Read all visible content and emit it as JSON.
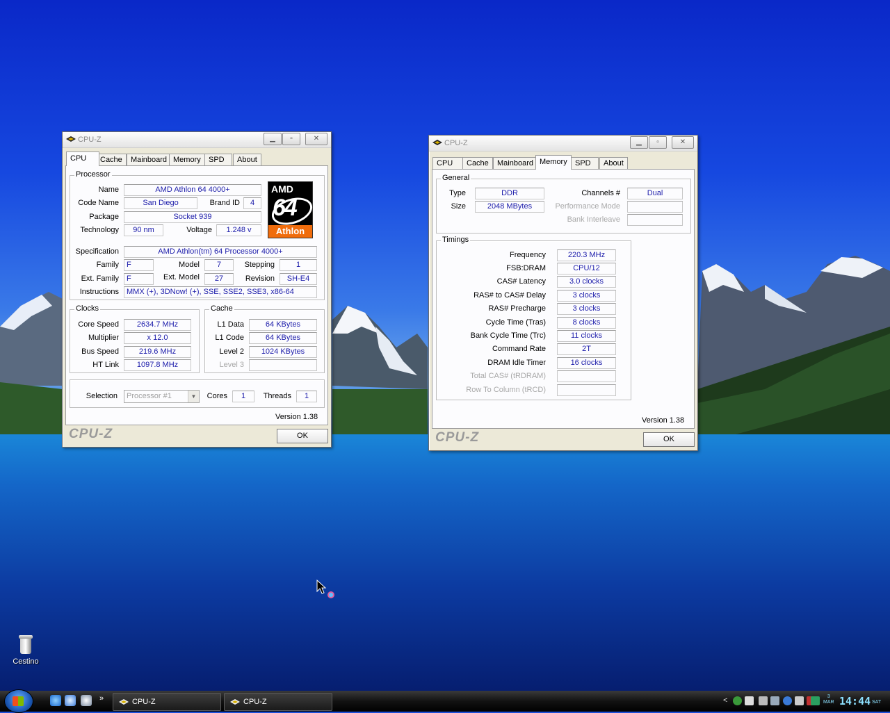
{
  "desktop": {
    "icons": [
      {
        "label": "Cestino",
        "icon": "recycle-bin-icon"
      }
    ]
  },
  "cpu_window": {
    "title": "CPU-Z",
    "tabs": [
      "CPU",
      "Cache",
      "Mainboard",
      "Memory",
      "SPD",
      "About"
    ],
    "active_tab": "CPU",
    "processor": {
      "legend": "Processor",
      "name_label": "Name",
      "name": "AMD Athlon 64 4000+",
      "codename_label": "Code Name",
      "codename": "San Diego",
      "brandid_label": "Brand ID",
      "brandid": "4",
      "package_label": "Package",
      "package": "Socket 939",
      "technology_label": "Technology",
      "technology": "90 nm",
      "voltage_label": "Voltage",
      "voltage": "1.248 v",
      "spec_label": "Specification",
      "spec": "AMD Athlon(tm) 64 Processor 4000+",
      "family_label": "Family",
      "family": "F",
      "model_label": "Model",
      "model": "7",
      "stepping_label": "Stepping",
      "stepping": "1",
      "extfamily_label": "Ext. Family",
      "extfamily": "F",
      "extmodel_label": "Ext. Model",
      "extmodel": "27",
      "revision_label": "Revision",
      "revision": "SH-E4",
      "instructions_label": "Instructions",
      "instructions": "MMX (+), 3DNow! (+), SSE, SSE2, SSE3, x86-64"
    },
    "logo": {
      "top": "AMD",
      "middle": "64",
      "bottom": "Athlon"
    },
    "clocks": {
      "legend": "Clocks",
      "core_label": "Core Speed",
      "core": "2634.7 MHz",
      "mult_label": "Multiplier",
      "mult": "x 12.0",
      "bus_label": "Bus Speed",
      "bus": "219.6 MHz",
      "ht_label": "HT Link",
      "ht": "1097.8 MHz"
    },
    "cache": {
      "legend": "Cache",
      "l1d_label": "L1 Data",
      "l1d": "64 KBytes",
      "l1c_label": "L1 Code",
      "l1c": "64 KBytes",
      "l2_label": "Level 2",
      "l2": "1024 KBytes",
      "l3_label": "Level 3",
      "l3": ""
    },
    "selection": {
      "label": "Selection",
      "value": "Processor #1",
      "cores_label": "Cores",
      "cores": "1",
      "threads_label": "Threads",
      "threads": "1"
    },
    "version": "Version 1.38",
    "brand": "CPU-Z",
    "ok_label": "OK"
  },
  "mem_window": {
    "title": "CPU-Z",
    "tabs": [
      "CPU",
      "Cache",
      "Mainboard",
      "Memory",
      "SPD",
      "About"
    ],
    "active_tab": "Memory",
    "general": {
      "legend": "General",
      "type_label": "Type",
      "type": "DDR",
      "size_label": "Size",
      "size": "2048 MBytes",
      "channels_label": "Channels #",
      "channels": "Dual",
      "perf_label": "Performance Mode",
      "perf": "",
      "interleave_label": "Bank Interleave",
      "interleave": ""
    },
    "timings": {
      "legend": "Timings",
      "rows": [
        {
          "label": "Frequency",
          "value": "220.3 MHz",
          "enabled": true
        },
        {
          "label": "FSB:DRAM",
          "value": "CPU/12",
          "enabled": true
        },
        {
          "label": "CAS# Latency",
          "value": "3.0 clocks",
          "enabled": true
        },
        {
          "label": "RAS# to CAS# Delay",
          "value": "3 clocks",
          "enabled": true
        },
        {
          "label": "RAS# Precharge",
          "value": "3 clocks",
          "enabled": true
        },
        {
          "label": "Cycle Time (Tras)",
          "value": "8 clocks",
          "enabled": true
        },
        {
          "label": "Bank Cycle Time (Trc)",
          "value": "11 clocks",
          "enabled": true
        },
        {
          "label": "Command Rate",
          "value": "2T",
          "enabled": true
        },
        {
          "label": "DRAM Idle Timer",
          "value": "16 clocks",
          "enabled": true
        },
        {
          "label": "Total CAS# (tRDRAM)",
          "value": "",
          "enabled": false
        },
        {
          "label": "Row To Column (tRCD)",
          "value": "",
          "enabled": false
        }
      ]
    },
    "version": "Version 1.38",
    "brand": "CPU-Z",
    "ok_label": "OK"
  },
  "taskbar": {
    "tasks": [
      {
        "label": "CPU-Z"
      },
      {
        "label": "CPU-Z"
      }
    ],
    "clock": "14:44",
    "day": "SAT",
    "date_day": "3",
    "date_month": "MAR"
  },
  "colors": {
    "field_text": "#1b1baa",
    "disabled_text": "#a8a8a8",
    "athlon_orange": "#f06c0c"
  }
}
